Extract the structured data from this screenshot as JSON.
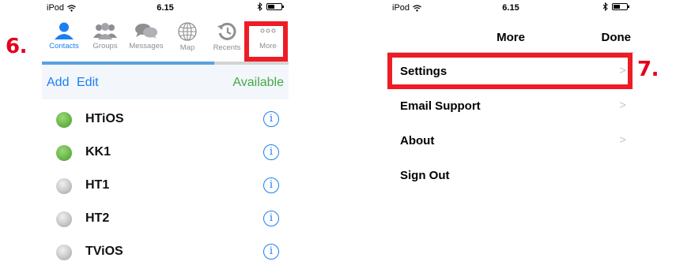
{
  "steps": {
    "left": "6.",
    "right": "7."
  },
  "left": {
    "status": {
      "carrier": "iPod",
      "time": "6.15"
    },
    "tabs": [
      {
        "label": "Contacts",
        "icon": "person-icon",
        "active": true
      },
      {
        "label": "Groups",
        "icon": "group-icon",
        "active": false
      },
      {
        "label": "Messages",
        "icon": "chat-bubbles-icon",
        "active": false
      },
      {
        "label": "Map",
        "icon": "globe-icon",
        "active": false
      },
      {
        "label": "Recents",
        "icon": "history-icon",
        "active": false
      },
      {
        "label": "More",
        "icon": "more-dots-icon",
        "active": false
      }
    ],
    "toolbar": {
      "add": "Add",
      "edit": "Edit",
      "status": "Available"
    },
    "contacts": [
      {
        "name": "HTiOS",
        "presence": "online"
      },
      {
        "name": "KK1",
        "presence": "online"
      },
      {
        "name": "HT1",
        "presence": "offline"
      },
      {
        "name": "HT2",
        "presence": "offline"
      },
      {
        "name": "TViOS",
        "presence": "offline"
      }
    ],
    "info_glyph": "i"
  },
  "right": {
    "status": {
      "carrier": "iPod",
      "time": "6.15"
    },
    "nav": {
      "title": "More",
      "done": "Done"
    },
    "menu": [
      {
        "label": "Settings",
        "chevron": true
      },
      {
        "label": "Email Support",
        "chevron": true
      },
      {
        "label": "About",
        "chevron": true
      },
      {
        "label": "Sign Out",
        "chevron": false
      }
    ],
    "chevron_glyph": ">"
  },
  "colors": {
    "accent_blue": "#1a7ff2",
    "available_green": "#46a946",
    "highlight_red": "#ee1c25"
  }
}
